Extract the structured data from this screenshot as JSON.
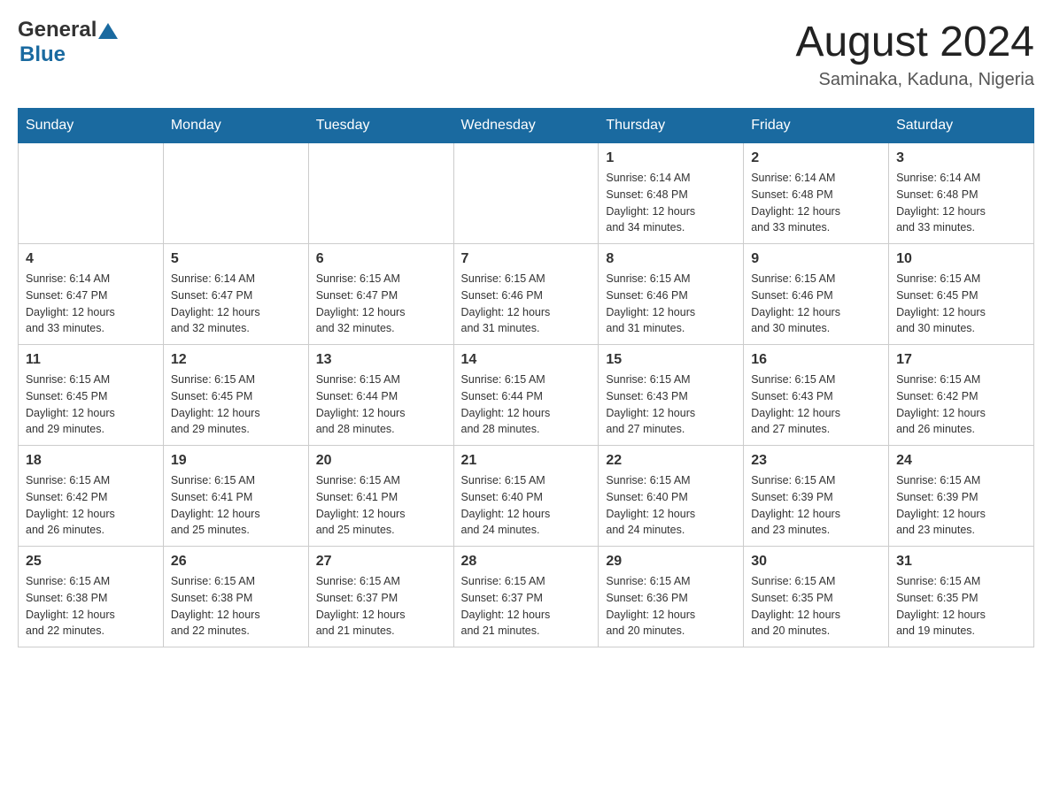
{
  "header": {
    "logo": {
      "text_general": "General",
      "text_blue": "Blue"
    },
    "month": "August 2024",
    "location": "Saminaka, Kaduna, Nigeria"
  },
  "weekdays": [
    "Sunday",
    "Monday",
    "Tuesday",
    "Wednesday",
    "Thursday",
    "Friday",
    "Saturday"
  ],
  "weeks": [
    [
      {
        "day": "",
        "info": ""
      },
      {
        "day": "",
        "info": ""
      },
      {
        "day": "",
        "info": ""
      },
      {
        "day": "",
        "info": ""
      },
      {
        "day": "1",
        "info": "Sunrise: 6:14 AM\nSunset: 6:48 PM\nDaylight: 12 hours\nand 34 minutes."
      },
      {
        "day": "2",
        "info": "Sunrise: 6:14 AM\nSunset: 6:48 PM\nDaylight: 12 hours\nand 33 minutes."
      },
      {
        "day": "3",
        "info": "Sunrise: 6:14 AM\nSunset: 6:48 PM\nDaylight: 12 hours\nand 33 minutes."
      }
    ],
    [
      {
        "day": "4",
        "info": "Sunrise: 6:14 AM\nSunset: 6:47 PM\nDaylight: 12 hours\nand 33 minutes."
      },
      {
        "day": "5",
        "info": "Sunrise: 6:14 AM\nSunset: 6:47 PM\nDaylight: 12 hours\nand 32 minutes."
      },
      {
        "day": "6",
        "info": "Sunrise: 6:15 AM\nSunset: 6:47 PM\nDaylight: 12 hours\nand 32 minutes."
      },
      {
        "day": "7",
        "info": "Sunrise: 6:15 AM\nSunset: 6:46 PM\nDaylight: 12 hours\nand 31 minutes."
      },
      {
        "day": "8",
        "info": "Sunrise: 6:15 AM\nSunset: 6:46 PM\nDaylight: 12 hours\nand 31 minutes."
      },
      {
        "day": "9",
        "info": "Sunrise: 6:15 AM\nSunset: 6:46 PM\nDaylight: 12 hours\nand 30 minutes."
      },
      {
        "day": "10",
        "info": "Sunrise: 6:15 AM\nSunset: 6:45 PM\nDaylight: 12 hours\nand 30 minutes."
      }
    ],
    [
      {
        "day": "11",
        "info": "Sunrise: 6:15 AM\nSunset: 6:45 PM\nDaylight: 12 hours\nand 29 minutes."
      },
      {
        "day": "12",
        "info": "Sunrise: 6:15 AM\nSunset: 6:45 PM\nDaylight: 12 hours\nand 29 minutes."
      },
      {
        "day": "13",
        "info": "Sunrise: 6:15 AM\nSunset: 6:44 PM\nDaylight: 12 hours\nand 28 minutes."
      },
      {
        "day": "14",
        "info": "Sunrise: 6:15 AM\nSunset: 6:44 PM\nDaylight: 12 hours\nand 28 minutes."
      },
      {
        "day": "15",
        "info": "Sunrise: 6:15 AM\nSunset: 6:43 PM\nDaylight: 12 hours\nand 27 minutes."
      },
      {
        "day": "16",
        "info": "Sunrise: 6:15 AM\nSunset: 6:43 PM\nDaylight: 12 hours\nand 27 minutes."
      },
      {
        "day": "17",
        "info": "Sunrise: 6:15 AM\nSunset: 6:42 PM\nDaylight: 12 hours\nand 26 minutes."
      }
    ],
    [
      {
        "day": "18",
        "info": "Sunrise: 6:15 AM\nSunset: 6:42 PM\nDaylight: 12 hours\nand 26 minutes."
      },
      {
        "day": "19",
        "info": "Sunrise: 6:15 AM\nSunset: 6:41 PM\nDaylight: 12 hours\nand 25 minutes."
      },
      {
        "day": "20",
        "info": "Sunrise: 6:15 AM\nSunset: 6:41 PM\nDaylight: 12 hours\nand 25 minutes."
      },
      {
        "day": "21",
        "info": "Sunrise: 6:15 AM\nSunset: 6:40 PM\nDaylight: 12 hours\nand 24 minutes."
      },
      {
        "day": "22",
        "info": "Sunrise: 6:15 AM\nSunset: 6:40 PM\nDaylight: 12 hours\nand 24 minutes."
      },
      {
        "day": "23",
        "info": "Sunrise: 6:15 AM\nSunset: 6:39 PM\nDaylight: 12 hours\nand 23 minutes."
      },
      {
        "day": "24",
        "info": "Sunrise: 6:15 AM\nSunset: 6:39 PM\nDaylight: 12 hours\nand 23 minutes."
      }
    ],
    [
      {
        "day": "25",
        "info": "Sunrise: 6:15 AM\nSunset: 6:38 PM\nDaylight: 12 hours\nand 22 minutes."
      },
      {
        "day": "26",
        "info": "Sunrise: 6:15 AM\nSunset: 6:38 PM\nDaylight: 12 hours\nand 22 minutes."
      },
      {
        "day": "27",
        "info": "Sunrise: 6:15 AM\nSunset: 6:37 PM\nDaylight: 12 hours\nand 21 minutes."
      },
      {
        "day": "28",
        "info": "Sunrise: 6:15 AM\nSunset: 6:37 PM\nDaylight: 12 hours\nand 21 minutes."
      },
      {
        "day": "29",
        "info": "Sunrise: 6:15 AM\nSunset: 6:36 PM\nDaylight: 12 hours\nand 20 minutes."
      },
      {
        "day": "30",
        "info": "Sunrise: 6:15 AM\nSunset: 6:35 PM\nDaylight: 12 hours\nand 20 minutes."
      },
      {
        "day": "31",
        "info": "Sunrise: 6:15 AM\nSunset: 6:35 PM\nDaylight: 12 hours\nand 19 minutes."
      }
    ]
  ]
}
